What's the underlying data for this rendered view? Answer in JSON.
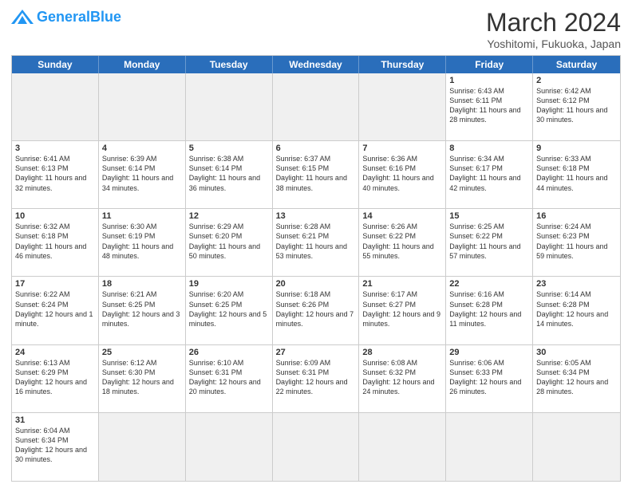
{
  "header": {
    "logo_general": "General",
    "logo_blue": "Blue",
    "month_title": "March 2024",
    "location": "Yoshitomi, Fukuoka, Japan"
  },
  "day_headers": [
    "Sunday",
    "Monday",
    "Tuesday",
    "Wednesday",
    "Thursday",
    "Friday",
    "Saturday"
  ],
  "weeks": [
    [
      {
        "day": "",
        "empty": true
      },
      {
        "day": "",
        "empty": true
      },
      {
        "day": "",
        "empty": true
      },
      {
        "day": "",
        "empty": true
      },
      {
        "day": "",
        "empty": true
      },
      {
        "day": "1",
        "info": "Sunrise: 6:43 AM\nSunset: 6:11 PM\nDaylight: 11 hours\nand 28 minutes."
      },
      {
        "day": "2",
        "info": "Sunrise: 6:42 AM\nSunset: 6:12 PM\nDaylight: 11 hours\nand 30 minutes."
      }
    ],
    [
      {
        "day": "3",
        "info": "Sunrise: 6:41 AM\nSunset: 6:13 PM\nDaylight: 11 hours\nand 32 minutes."
      },
      {
        "day": "4",
        "info": "Sunrise: 6:39 AM\nSunset: 6:14 PM\nDaylight: 11 hours\nand 34 minutes."
      },
      {
        "day": "5",
        "info": "Sunrise: 6:38 AM\nSunset: 6:14 PM\nDaylight: 11 hours\nand 36 minutes."
      },
      {
        "day": "6",
        "info": "Sunrise: 6:37 AM\nSunset: 6:15 PM\nDaylight: 11 hours\nand 38 minutes."
      },
      {
        "day": "7",
        "info": "Sunrise: 6:36 AM\nSunset: 6:16 PM\nDaylight: 11 hours\nand 40 minutes."
      },
      {
        "day": "8",
        "info": "Sunrise: 6:34 AM\nSunset: 6:17 PM\nDaylight: 11 hours\nand 42 minutes."
      },
      {
        "day": "9",
        "info": "Sunrise: 6:33 AM\nSunset: 6:18 PM\nDaylight: 11 hours\nand 44 minutes."
      }
    ],
    [
      {
        "day": "10",
        "info": "Sunrise: 6:32 AM\nSunset: 6:18 PM\nDaylight: 11 hours\nand 46 minutes."
      },
      {
        "day": "11",
        "info": "Sunrise: 6:30 AM\nSunset: 6:19 PM\nDaylight: 11 hours\nand 48 minutes."
      },
      {
        "day": "12",
        "info": "Sunrise: 6:29 AM\nSunset: 6:20 PM\nDaylight: 11 hours\nand 50 minutes."
      },
      {
        "day": "13",
        "info": "Sunrise: 6:28 AM\nSunset: 6:21 PM\nDaylight: 11 hours\nand 53 minutes."
      },
      {
        "day": "14",
        "info": "Sunrise: 6:26 AM\nSunset: 6:22 PM\nDaylight: 11 hours\nand 55 minutes."
      },
      {
        "day": "15",
        "info": "Sunrise: 6:25 AM\nSunset: 6:22 PM\nDaylight: 11 hours\nand 57 minutes."
      },
      {
        "day": "16",
        "info": "Sunrise: 6:24 AM\nSunset: 6:23 PM\nDaylight: 11 hours\nand 59 minutes."
      }
    ],
    [
      {
        "day": "17",
        "info": "Sunrise: 6:22 AM\nSunset: 6:24 PM\nDaylight: 12 hours\nand 1 minute."
      },
      {
        "day": "18",
        "info": "Sunrise: 6:21 AM\nSunset: 6:25 PM\nDaylight: 12 hours\nand 3 minutes."
      },
      {
        "day": "19",
        "info": "Sunrise: 6:20 AM\nSunset: 6:25 PM\nDaylight: 12 hours\nand 5 minutes."
      },
      {
        "day": "20",
        "info": "Sunrise: 6:18 AM\nSunset: 6:26 PM\nDaylight: 12 hours\nand 7 minutes."
      },
      {
        "day": "21",
        "info": "Sunrise: 6:17 AM\nSunset: 6:27 PM\nDaylight: 12 hours\nand 9 minutes."
      },
      {
        "day": "22",
        "info": "Sunrise: 6:16 AM\nSunset: 6:28 PM\nDaylight: 12 hours\nand 11 minutes."
      },
      {
        "day": "23",
        "info": "Sunrise: 6:14 AM\nSunset: 6:28 PM\nDaylight: 12 hours\nand 14 minutes."
      }
    ],
    [
      {
        "day": "24",
        "info": "Sunrise: 6:13 AM\nSunset: 6:29 PM\nDaylight: 12 hours\nand 16 minutes."
      },
      {
        "day": "25",
        "info": "Sunrise: 6:12 AM\nSunset: 6:30 PM\nDaylight: 12 hours\nand 18 minutes."
      },
      {
        "day": "26",
        "info": "Sunrise: 6:10 AM\nSunset: 6:31 PM\nDaylight: 12 hours\nand 20 minutes."
      },
      {
        "day": "27",
        "info": "Sunrise: 6:09 AM\nSunset: 6:31 PM\nDaylight: 12 hours\nand 22 minutes."
      },
      {
        "day": "28",
        "info": "Sunrise: 6:08 AM\nSunset: 6:32 PM\nDaylight: 12 hours\nand 24 minutes."
      },
      {
        "day": "29",
        "info": "Sunrise: 6:06 AM\nSunset: 6:33 PM\nDaylight: 12 hours\nand 26 minutes."
      },
      {
        "day": "30",
        "info": "Sunrise: 6:05 AM\nSunset: 6:34 PM\nDaylight: 12 hours\nand 28 minutes."
      }
    ],
    [
      {
        "day": "31",
        "info": "Sunrise: 6:04 AM\nSunset: 6:34 PM\nDaylight: 12 hours\nand 30 minutes."
      },
      {
        "day": "",
        "empty": true
      },
      {
        "day": "",
        "empty": true
      },
      {
        "day": "",
        "empty": true
      },
      {
        "day": "",
        "empty": true
      },
      {
        "day": "",
        "empty": true
      },
      {
        "day": "",
        "empty": true
      }
    ]
  ]
}
